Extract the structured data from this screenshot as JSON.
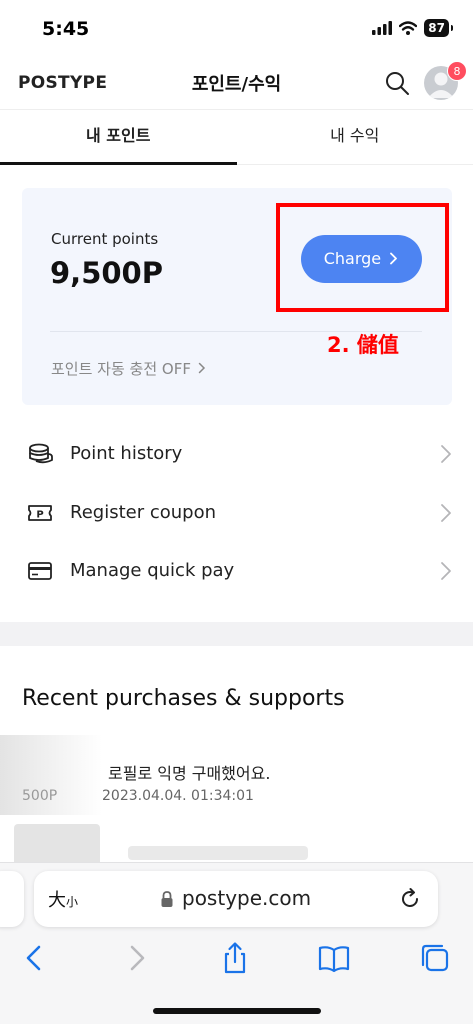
{
  "status_bar": {
    "time": "5:45",
    "battery": "87"
  },
  "header": {
    "logo": "POSTYPE",
    "title": "포인트/수익",
    "notification_count": "8"
  },
  "tabs": [
    {
      "label": "내 포인트",
      "active": true
    },
    {
      "label": "내 수익",
      "active": false
    }
  ],
  "points_card": {
    "current_label": "Current points",
    "current_value": "9,500P",
    "charge_label": "Charge",
    "autocharge_label": "포인트 자동 충전 OFF"
  },
  "annotation": {
    "text": "2. 儲值",
    "color": "#ff0000"
  },
  "menu": [
    {
      "label": "Point history",
      "icon": "coins-icon"
    },
    {
      "label": "Register coupon",
      "icon": "coupon-icon"
    },
    {
      "label": "Manage quick pay",
      "icon": "card-icon"
    }
  ],
  "recent": {
    "title": "Recent purchases & supports",
    "item": {
      "description": "로필로 익명 구매했어요.",
      "points": "500P",
      "date": "2023.04.04. 01:34:01"
    }
  },
  "browser": {
    "text_size_large": "大",
    "text_size_small": "小",
    "url": "postype.com"
  },
  "colors": {
    "accent": "#4d84f2",
    "card_bg": "#f3f6fd",
    "badge": "#ff4d5f",
    "ios_blue": "#1a73e8"
  }
}
